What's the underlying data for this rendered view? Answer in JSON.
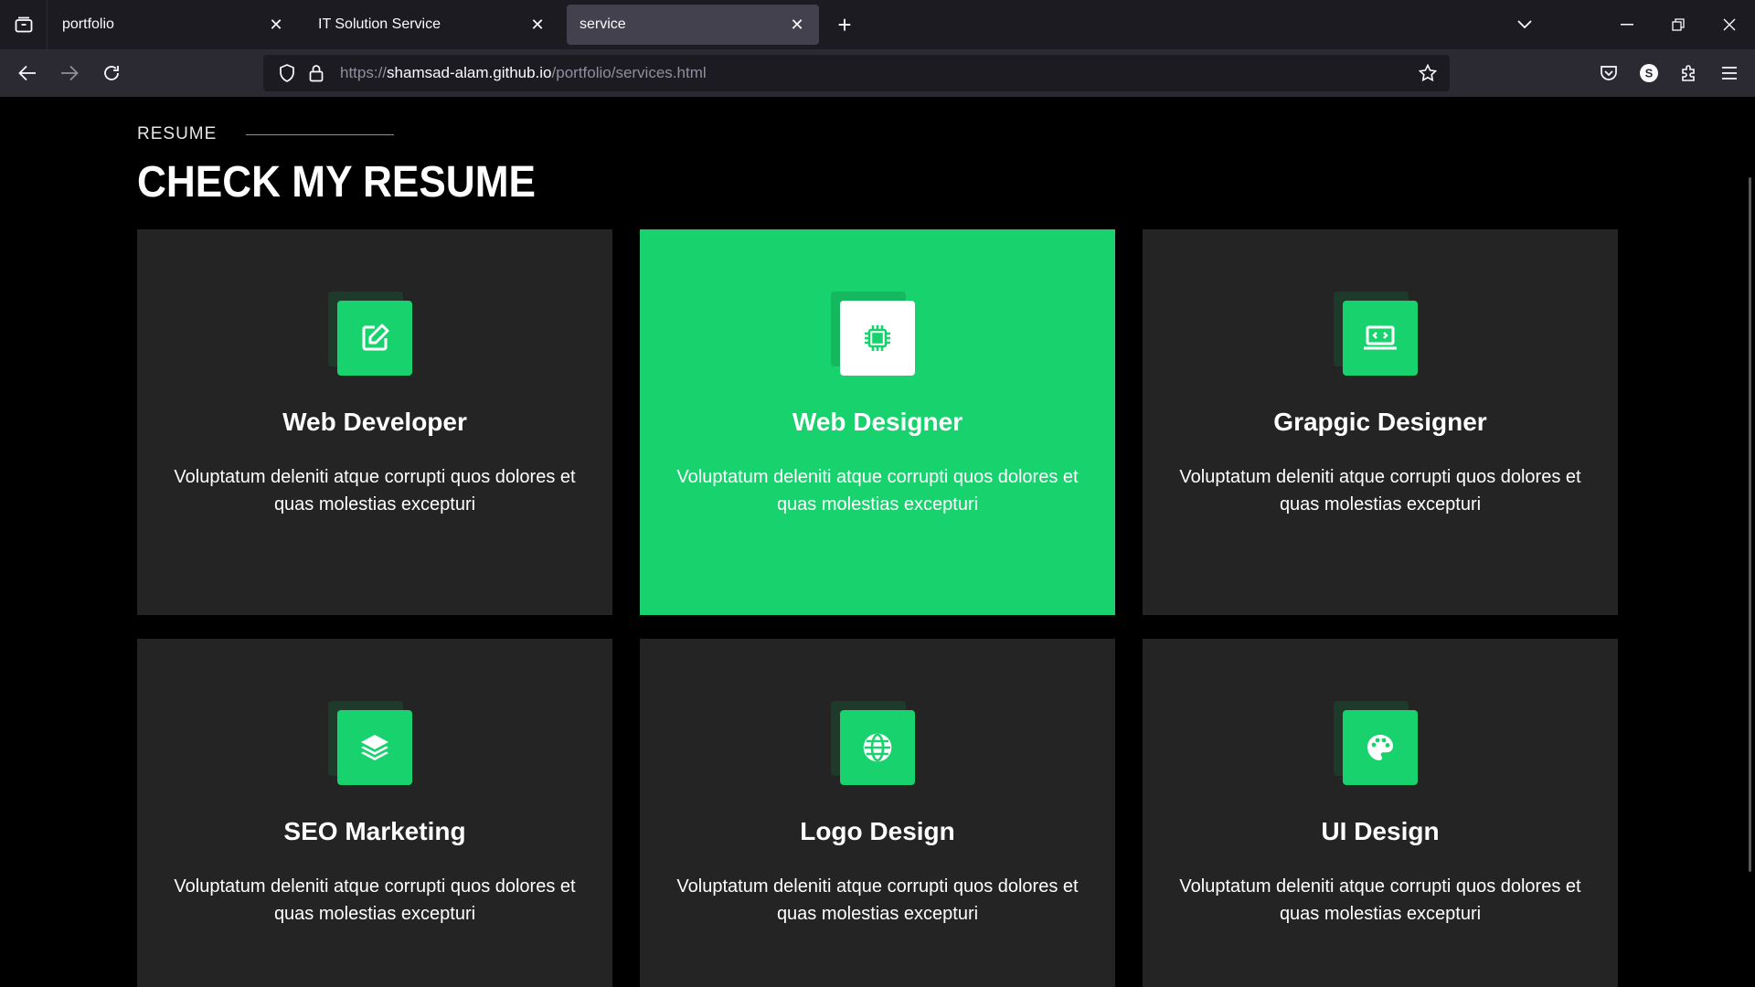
{
  "browser": {
    "tabs": [
      {
        "label": "portfolio"
      },
      {
        "label": "IT Solution Service"
      },
      {
        "label": "service"
      }
    ],
    "url": {
      "scheme": "https://",
      "host": "shamsad-alam.github.io",
      "path": "/portfolio/services.html"
    }
  },
  "section": {
    "eyebrow": "RESUME",
    "title": "CHECK MY RESUME"
  },
  "services": [
    {
      "title": "Web Developer",
      "desc": "Voluptatum deleniti atque corrupti quos dolores et quas molestias excepturi",
      "icon": "edit-icon"
    },
    {
      "title": "Web Designer",
      "desc": "Voluptatum deleniti atque corrupti quos dolores et quas molestias excepturi",
      "icon": "cpu-icon"
    },
    {
      "title": "Grapgic Designer",
      "desc": "Voluptatum deleniti atque corrupti quos dolores et quas molestias excepturi",
      "icon": "laptop-code-icon"
    },
    {
      "title": "SEO Marketing",
      "desc": "Voluptatum deleniti atque corrupti quos dolores et quas molestias excepturi",
      "icon": "layers-icon"
    },
    {
      "title": "Logo Design",
      "desc": "Voluptatum deleniti atque corrupti quos dolores et quas molestias excepturi",
      "icon": "globe-icon"
    },
    {
      "title": "UI Design",
      "desc": "Voluptatum deleniti atque corrupti quos dolores et quas molestias excepturi",
      "icon": "palette-icon"
    }
  ],
  "colors": {
    "accent": "#18d26e",
    "card": "#242424",
    "background": "#000000"
  }
}
